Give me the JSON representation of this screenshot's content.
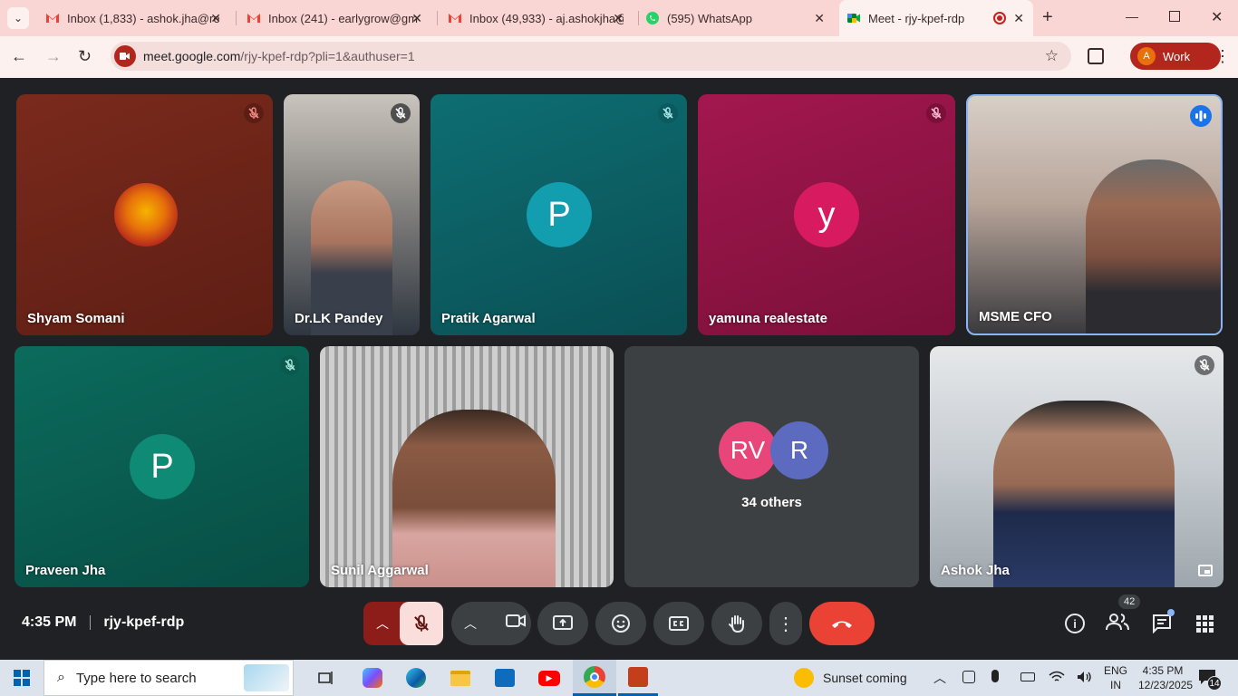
{
  "tabs": [
    {
      "title": "Inbox (1,833) - ashok.jha@re",
      "icon": "gmail-icon"
    },
    {
      "title": "Inbox (241) - earlygrow@gm",
      "icon": "gmail-icon"
    },
    {
      "title": "Inbox (49,933) - aj.ashokjha@",
      "icon": "gmail-icon"
    },
    {
      "title": "(595) WhatsApp",
      "icon": "whatsapp-icon"
    },
    {
      "title": "Meet - rjy-kpef-rdp",
      "icon": "meet-icon",
      "active": true
    }
  ],
  "address": {
    "host": "meet.google.com",
    "path": "/rjy-kpef-rdp?pli=1&authuser=1"
  },
  "profile": {
    "initial": "A",
    "label": "Work"
  },
  "participants": [
    {
      "name": "Shyam Somani"
    },
    {
      "name": "Dr.LK Pandey"
    },
    {
      "name": "Pratik Agarwal",
      "avatar": "P"
    },
    {
      "name": "yamuna realestate",
      "avatar": "y"
    },
    {
      "name": "MSME CFO"
    },
    {
      "name": "Praveen Jha",
      "avatar": "P"
    },
    {
      "name": "Sunil Aggarwal"
    },
    {
      "name": "Ashok Jha"
    }
  ],
  "others": {
    "avatars": [
      "RV",
      "R"
    ],
    "label": "34 others"
  },
  "meeting": {
    "time": "4:35 PM",
    "code": "rjy-kpef-rdp",
    "people_count": "42"
  },
  "taskbar": {
    "search_placeholder": "Type here to search",
    "weather": "Sunset coming",
    "lang": "ENG",
    "region": "IN",
    "clock_time": "4:35 PM",
    "clock_date": "12/23/2025",
    "notifications": "14"
  },
  "colors": {
    "accent_red": "#ea4335",
    "end_call": "#ea4335",
    "teal": "#0b7a7e",
    "magenta": "#c2185b"
  }
}
